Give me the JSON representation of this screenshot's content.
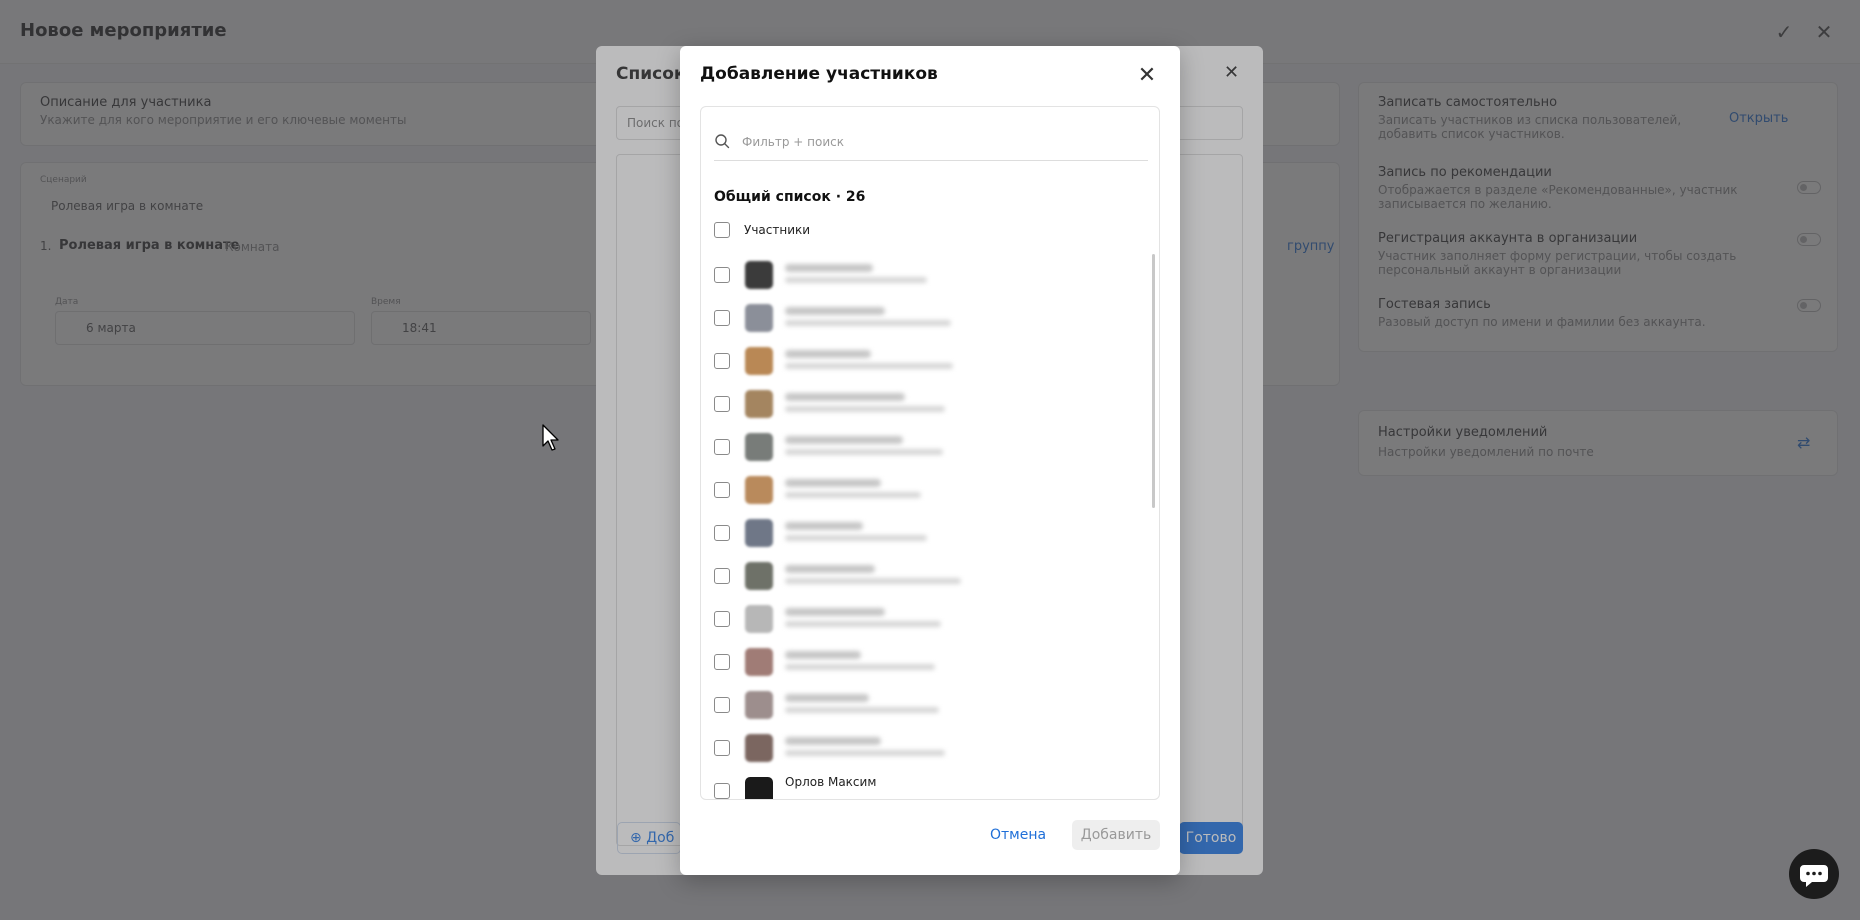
{
  "page": {
    "title": "Новое мероприятие",
    "description_label": "Описание для участника",
    "description_placeholder": "Укажите для кого мероприятие и его ключевые моменты",
    "scenario_label": "Сценарий",
    "scenario_value": "Ролевая игра в комнате",
    "item_number": "1.",
    "item_title": "Ролевая игра в комнате",
    "item_tag": "Комната",
    "add_group": "группу",
    "date_label": "Дата",
    "date_value": "6 марта",
    "time_label": "Время",
    "time_value": "18:41"
  },
  "right_panel": {
    "self_title": "Записать самостоятельно",
    "self_desc": "Записать участников из списка пользователей, добавить список участников.",
    "open_label": "Открыть",
    "rec_title": "Запись по рекомендации",
    "rec_desc": "Отображается в разделе «Рекомендованные», участник записывается по желанию.",
    "reg_title": "Регистрация аккаунта в организации",
    "reg_desc": "Участник заполняет форму регистрации, чтобы создать персональный аккаунт в организации",
    "guest_title": "Гостевая запись",
    "guest_desc": "Разовый доступ по имени и фамилии без аккаунта.",
    "notify_title": "Настройки уведомлений",
    "notify_desc": "Настройки уведомлений по почте"
  },
  "back_modal": {
    "title": "Список",
    "search_placeholder": "Поиск по",
    "add_label": "Доб",
    "done_label": "Готово"
  },
  "modal": {
    "title": "Добавление участников",
    "search_placeholder": "Фильтр + поиск",
    "list_heading": "Общий список · 26",
    "select_all_label": "Участники",
    "last_visible_name": "Орлов Максим",
    "cancel_label": "Отмена",
    "add_label": "Добавить"
  },
  "colors": {
    "accent": "#1f6fd8",
    "avatars": [
      "#3b3b3b",
      "#8b8f99",
      "#b98855",
      "#a48560",
      "#787c79",
      "#b98a5c",
      "#6f7787",
      "#6e7168",
      "#b7b7b7",
      "#a07c76",
      "#9d8e8d",
      "#7b6660"
    ]
  }
}
